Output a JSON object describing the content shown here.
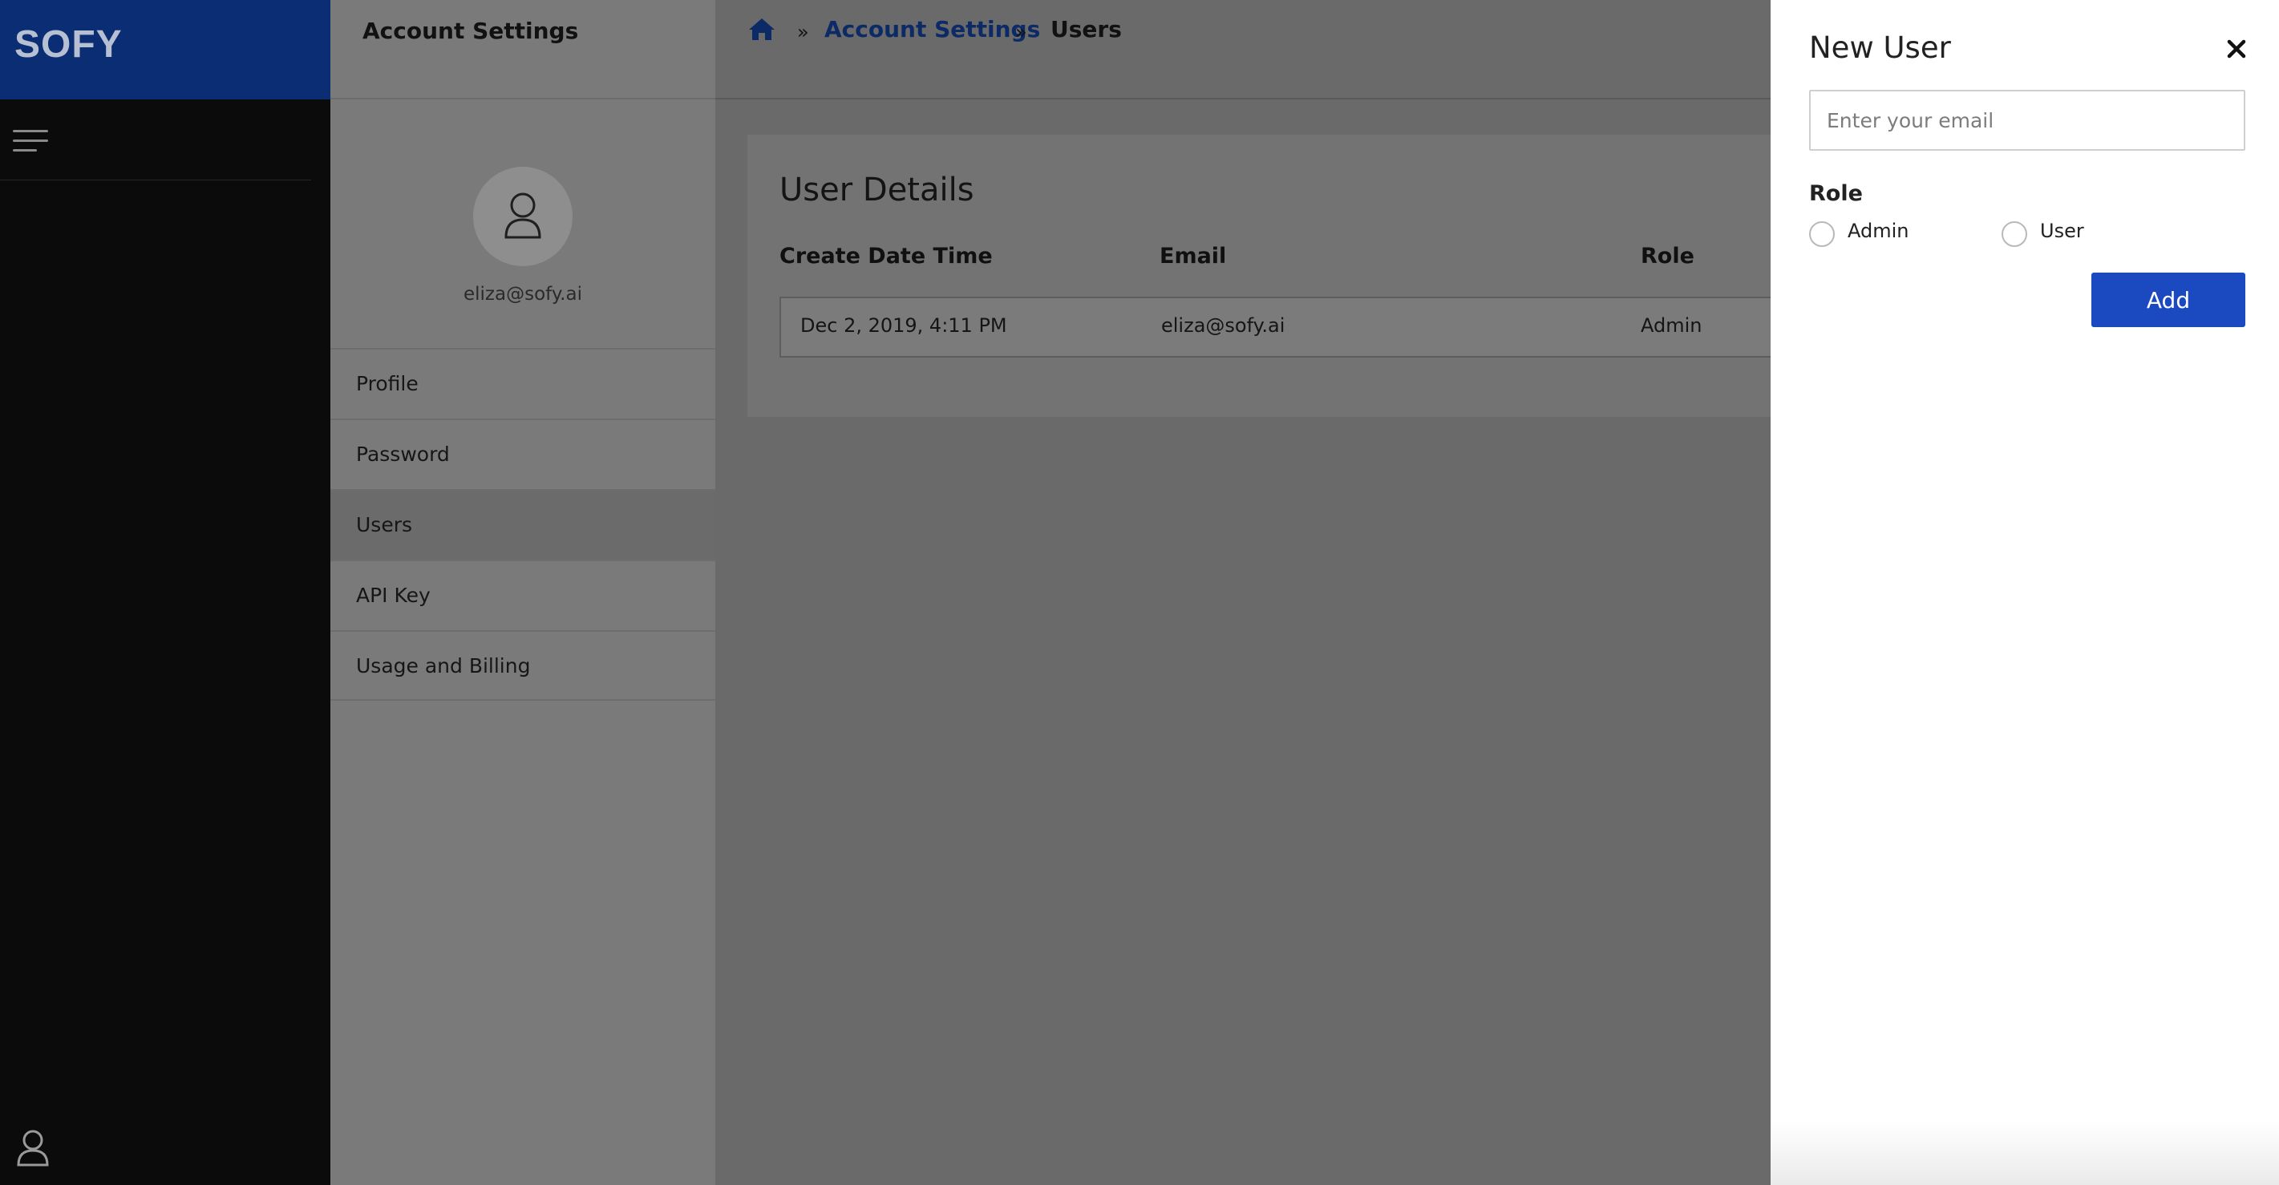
{
  "brand": {
    "logo_text": "SOFY"
  },
  "settings": {
    "title": "Account Settings",
    "user_email": "eliza@sofy.ai",
    "menu": [
      {
        "label": "Profile"
      },
      {
        "label": "Password"
      },
      {
        "label": "Users",
        "active": true
      },
      {
        "label": "API Key"
      },
      {
        "label": "Usage and Billing"
      }
    ]
  },
  "breadcrumb": {
    "home_icon": "home-icon",
    "items": [
      {
        "label": "Account Settings",
        "link": true
      },
      {
        "label": "Users",
        "link": false
      }
    ],
    "separator": "»"
  },
  "user_details": {
    "title": "User Details",
    "columns": [
      "Create Date Time",
      "Email",
      "Role"
    ],
    "rows": [
      {
        "create_date_time": "Dec 2, 2019, 4:11 PM",
        "email": "eliza@sofy.ai",
        "role": "Admin"
      }
    ]
  },
  "new_user": {
    "title": "New User",
    "email_placeholder": "Enter your email",
    "role_label": "Role",
    "roles": [
      {
        "label": "Admin",
        "selected": false
      },
      {
        "label": "User",
        "selected": false
      }
    ],
    "add_label": "Add"
  },
  "colors": {
    "brand_blue": "#0b2d73",
    "link_blue": "#0c2a66",
    "button_blue": "#1a49c0"
  }
}
